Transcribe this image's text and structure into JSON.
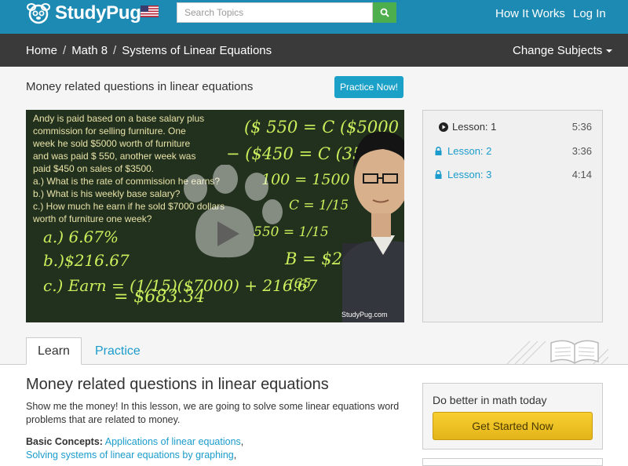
{
  "header": {
    "logo_text": "StudyPug",
    "search_placeholder": "Search Topics",
    "nav": [
      "How It Works",
      "Log In"
    ]
  },
  "breadcrumb": {
    "items": [
      "Home",
      "Math 8",
      "Systems of Linear Equations"
    ],
    "change_subjects": "Change Subjects"
  },
  "lesson": {
    "title": "Money related questions in linear equations",
    "practice_button": "Practice Now!"
  },
  "video": {
    "board_lines": [
      "Andy is paid based on a base salary plus",
      "commission for selling furniture. One",
      "week he sold $5000 worth of furniture",
      "and was paid $ 550, another week was",
      "paid $450 on sales of $3500.",
      "a.) What is the rate of commission he earns?",
      "b.) What is his weekly base salary?",
      "c.) How much he earn if he sold $7000 dollars",
      "     worth of furniture one week?"
    ],
    "watermark": "StudyPug.com"
  },
  "lessons": [
    {
      "label": "Lesson: 1",
      "duration": "5:36",
      "locked": false
    },
    {
      "label": "Lesson: 2",
      "duration": "3:36",
      "locked": true
    },
    {
      "label": "Lesson: 3",
      "duration": "4:14",
      "locked": true
    }
  ],
  "tabs": {
    "learn": "Learn",
    "practice": "Practice"
  },
  "content": {
    "heading": "Money related questions in linear equations",
    "description": "Show me the money! In this lesson, we are going to solve some linear equations word problems that are related to money.",
    "basic_concepts_label": "Basic Concepts:",
    "concepts": [
      "Applications of linear equations",
      "Solving systems of linear equations by graphing"
    ]
  },
  "cta": {
    "title": "Do better in math today",
    "button": "Get Started Now"
  },
  "colors": {
    "header_bg": "#1d8ab3",
    "breadcrumb_bg": "#3a3a3a",
    "link": "#1b9ccc",
    "search_button": "#4cae4c",
    "cta_button": "#f0c22a"
  }
}
